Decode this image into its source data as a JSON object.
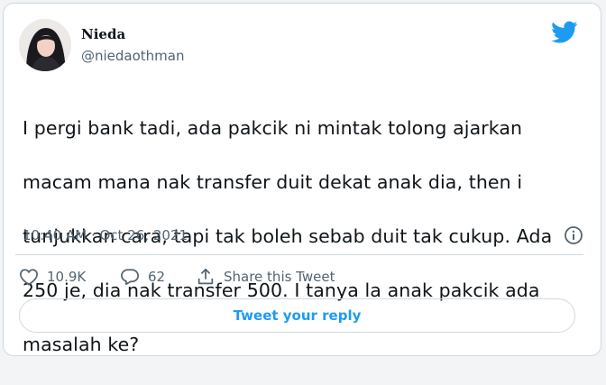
{
  "user": {
    "name": "Nieda",
    "handle": "@niedaothman",
    "avatar_icon": "profile-photo"
  },
  "tweet": {
    "text_lines": [
      "I pergi bank tadi, ada pakcik ni mintak tolong ajarkan",
      "macam mana nak transfer duit dekat anak dia, then i",
      "tunjukkan cara, tapi tak boleh sebab duit tak cukup. Ada",
      "250 je, dia nak transfer 500. I tanya la anak pakcik ada",
      "masalah ke?"
    ],
    "timestamp": "10:40 AM · Oct 26, 2021"
  },
  "actions": {
    "like_count": "10.9K",
    "reply_count": "62",
    "share_label": "Share this Tweet"
  },
  "reply_button": {
    "label": "Tweet your reply"
  },
  "colors": {
    "brand_blue": "#1d9bf0",
    "text_primary": "#0f1419",
    "text_secondary": "#536471",
    "border": "#cfd9de"
  }
}
